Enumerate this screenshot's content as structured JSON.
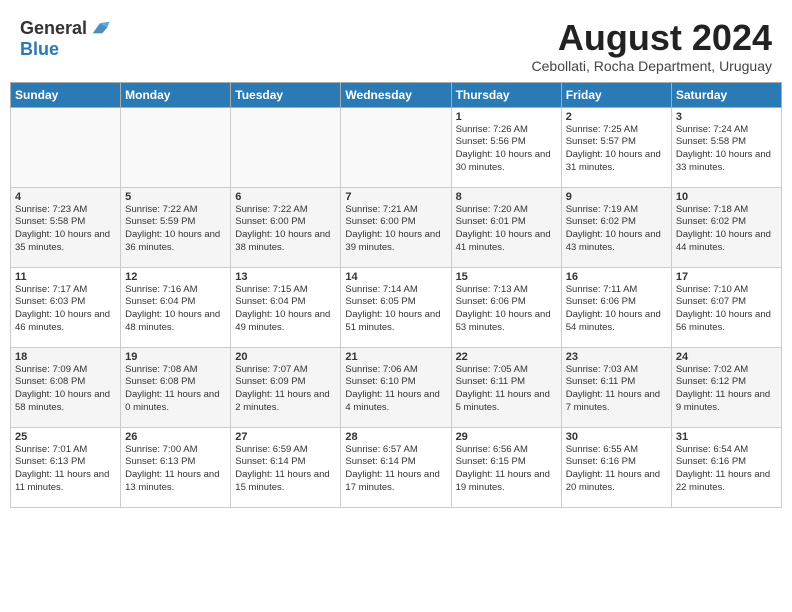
{
  "logo": {
    "general": "General",
    "blue": "Blue"
  },
  "title": "August 2024",
  "subtitle": "Cebollati, Rocha Department, Uruguay",
  "days_of_week": [
    "Sunday",
    "Monday",
    "Tuesday",
    "Wednesday",
    "Thursday",
    "Friday",
    "Saturday"
  ],
  "weeks": [
    [
      {
        "day": "",
        "info": ""
      },
      {
        "day": "",
        "info": ""
      },
      {
        "day": "",
        "info": ""
      },
      {
        "day": "",
        "info": ""
      },
      {
        "day": "1",
        "info": "Sunrise: 7:26 AM\nSunset: 5:56 PM\nDaylight: 10 hours and 30 minutes."
      },
      {
        "day": "2",
        "info": "Sunrise: 7:25 AM\nSunset: 5:57 PM\nDaylight: 10 hours and 31 minutes."
      },
      {
        "day": "3",
        "info": "Sunrise: 7:24 AM\nSunset: 5:58 PM\nDaylight: 10 hours and 33 minutes."
      }
    ],
    [
      {
        "day": "4",
        "info": "Sunrise: 7:23 AM\nSunset: 5:58 PM\nDaylight: 10 hours and 35 minutes."
      },
      {
        "day": "5",
        "info": "Sunrise: 7:22 AM\nSunset: 5:59 PM\nDaylight: 10 hours and 36 minutes."
      },
      {
        "day": "6",
        "info": "Sunrise: 7:22 AM\nSunset: 6:00 PM\nDaylight: 10 hours and 38 minutes."
      },
      {
        "day": "7",
        "info": "Sunrise: 7:21 AM\nSunset: 6:00 PM\nDaylight: 10 hours and 39 minutes."
      },
      {
        "day": "8",
        "info": "Sunrise: 7:20 AM\nSunset: 6:01 PM\nDaylight: 10 hours and 41 minutes."
      },
      {
        "day": "9",
        "info": "Sunrise: 7:19 AM\nSunset: 6:02 PM\nDaylight: 10 hours and 43 minutes."
      },
      {
        "day": "10",
        "info": "Sunrise: 7:18 AM\nSunset: 6:02 PM\nDaylight: 10 hours and 44 minutes."
      }
    ],
    [
      {
        "day": "11",
        "info": "Sunrise: 7:17 AM\nSunset: 6:03 PM\nDaylight: 10 hours and 46 minutes."
      },
      {
        "day": "12",
        "info": "Sunrise: 7:16 AM\nSunset: 6:04 PM\nDaylight: 10 hours and 48 minutes."
      },
      {
        "day": "13",
        "info": "Sunrise: 7:15 AM\nSunset: 6:04 PM\nDaylight: 10 hours and 49 minutes."
      },
      {
        "day": "14",
        "info": "Sunrise: 7:14 AM\nSunset: 6:05 PM\nDaylight: 10 hours and 51 minutes."
      },
      {
        "day": "15",
        "info": "Sunrise: 7:13 AM\nSunset: 6:06 PM\nDaylight: 10 hours and 53 minutes."
      },
      {
        "day": "16",
        "info": "Sunrise: 7:11 AM\nSunset: 6:06 PM\nDaylight: 10 hours and 54 minutes."
      },
      {
        "day": "17",
        "info": "Sunrise: 7:10 AM\nSunset: 6:07 PM\nDaylight: 10 hours and 56 minutes."
      }
    ],
    [
      {
        "day": "18",
        "info": "Sunrise: 7:09 AM\nSunset: 6:08 PM\nDaylight: 10 hours and 58 minutes."
      },
      {
        "day": "19",
        "info": "Sunrise: 7:08 AM\nSunset: 6:08 PM\nDaylight: 11 hours and 0 minutes."
      },
      {
        "day": "20",
        "info": "Sunrise: 7:07 AM\nSunset: 6:09 PM\nDaylight: 11 hours and 2 minutes."
      },
      {
        "day": "21",
        "info": "Sunrise: 7:06 AM\nSunset: 6:10 PM\nDaylight: 11 hours and 4 minutes."
      },
      {
        "day": "22",
        "info": "Sunrise: 7:05 AM\nSunset: 6:11 PM\nDaylight: 11 hours and 5 minutes."
      },
      {
        "day": "23",
        "info": "Sunrise: 7:03 AM\nSunset: 6:11 PM\nDaylight: 11 hours and 7 minutes."
      },
      {
        "day": "24",
        "info": "Sunrise: 7:02 AM\nSunset: 6:12 PM\nDaylight: 11 hours and 9 minutes."
      }
    ],
    [
      {
        "day": "25",
        "info": "Sunrise: 7:01 AM\nSunset: 6:13 PM\nDaylight: 11 hours and 11 minutes."
      },
      {
        "day": "26",
        "info": "Sunrise: 7:00 AM\nSunset: 6:13 PM\nDaylight: 11 hours and 13 minutes."
      },
      {
        "day": "27",
        "info": "Sunrise: 6:59 AM\nSunset: 6:14 PM\nDaylight: 11 hours and 15 minutes."
      },
      {
        "day": "28",
        "info": "Sunrise: 6:57 AM\nSunset: 6:14 PM\nDaylight: 11 hours and 17 minutes."
      },
      {
        "day": "29",
        "info": "Sunrise: 6:56 AM\nSunset: 6:15 PM\nDaylight: 11 hours and 19 minutes."
      },
      {
        "day": "30",
        "info": "Sunrise: 6:55 AM\nSunset: 6:16 PM\nDaylight: 11 hours and 20 minutes."
      },
      {
        "day": "31",
        "info": "Sunrise: 6:54 AM\nSunset: 6:16 PM\nDaylight: 11 hours and 22 minutes."
      }
    ]
  ]
}
